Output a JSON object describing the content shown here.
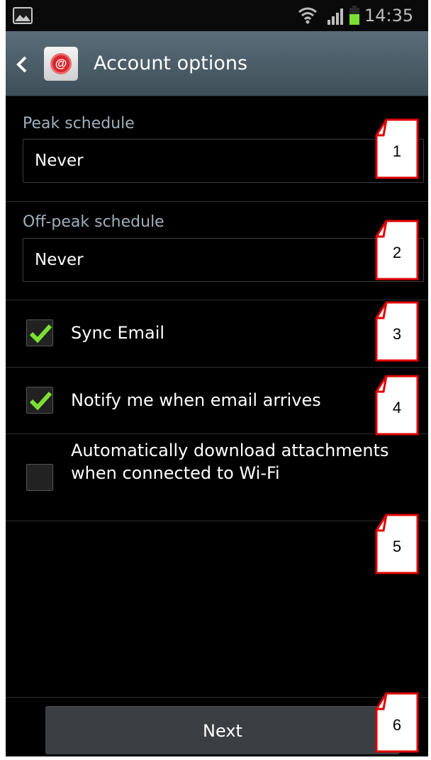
{
  "status_bar": {
    "time": "14:35",
    "icons": [
      "picture-icon",
      "wifi-icon",
      "signal-icon",
      "battery-icon"
    ]
  },
  "action_bar": {
    "title": "Account options",
    "icon": "email-at-icon"
  },
  "peak_schedule": {
    "label": "Peak schedule",
    "value": "Never"
  },
  "offpeak_schedule": {
    "label": "Off-peak schedule",
    "value": "Never"
  },
  "options": [
    {
      "label": "Sync Email",
      "checked": true
    },
    {
      "label": "Notify me when email arrives",
      "checked": true
    },
    {
      "label": "Automatically download attachments when connected to Wi-Fi",
      "checked": false
    }
  ],
  "footer": {
    "next_label": "Next"
  },
  "annotations": [
    "1",
    "2",
    "3",
    "4",
    "5",
    "6"
  ],
  "colors": {
    "check": "#7be033",
    "annotation": "#e00000",
    "label": "#9fb0bc"
  }
}
